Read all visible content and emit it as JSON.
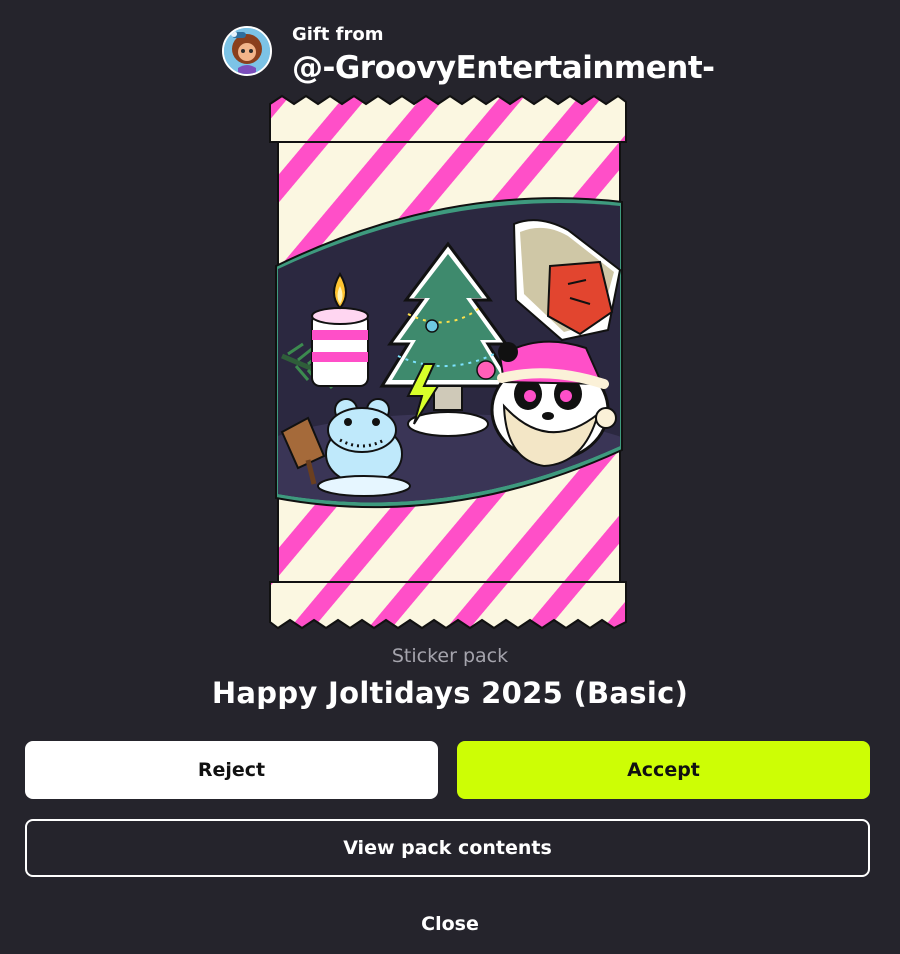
{
  "gift": {
    "from_label": "Gift from",
    "sender_username": "@-GroovyEntertainment-"
  },
  "pack": {
    "type_label": "Sticker pack",
    "title": "Happy Joltidays 2025 (Basic)"
  },
  "actions": {
    "reject_label": "Reject",
    "accept_label": "Accept",
    "view_label": "View pack contents",
    "close_label": "Close"
  },
  "colors": {
    "background": "#25242c",
    "accent": "#cdfe05",
    "stripe": "#ff4fc8",
    "wrapper": "#fbf7e1",
    "window_frame": "#3e9a7e"
  },
  "icons": {
    "avatar": "user-avatar-icon",
    "pack_stickers": [
      "candle-icon",
      "pine-branch-icon",
      "christmas-tree-icon",
      "lightning-bolt-icon",
      "santa-hat-character-icon",
      "panda-santa-icon",
      "snowman-frog-icon",
      "wooden-sign-icon"
    ]
  }
}
